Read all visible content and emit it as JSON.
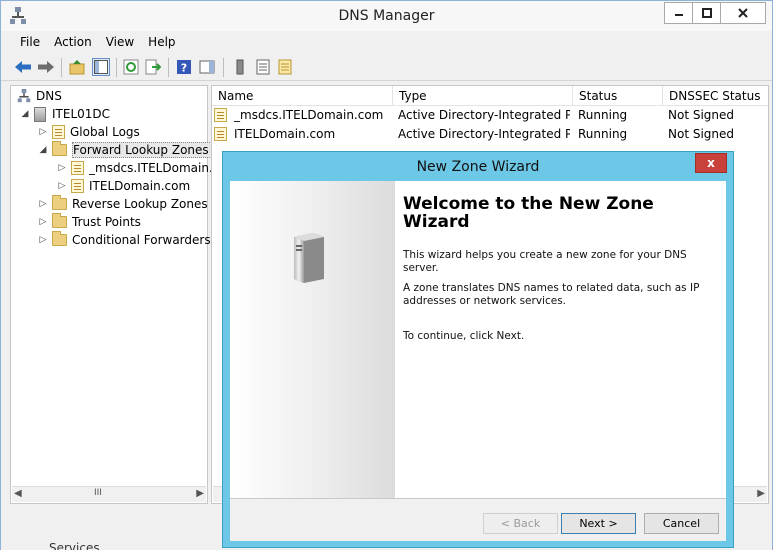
{
  "window": {
    "title": "DNS Manager"
  },
  "menu": [
    "File",
    "Action",
    "View",
    "Help"
  ],
  "tree": {
    "root": "DNS",
    "server": "ITEL01DC",
    "items": [
      {
        "label": "Global Logs"
      },
      {
        "label": "Forward Lookup Zones"
      },
      {
        "label": "_msdcs.ITELDomain.c"
      },
      {
        "label": "ITELDomain.com"
      },
      {
        "label": "Reverse Lookup Zones"
      },
      {
        "label": "Trust Points"
      },
      {
        "label": "Conditional Forwarders"
      }
    ]
  },
  "list": {
    "columns": [
      "Name",
      "Type",
      "Status",
      "DNSSEC Status"
    ],
    "rows": [
      {
        "name": "_msdcs.ITELDomain.com",
        "type": "Active Directory-Integrated Pr...",
        "status": "Running",
        "dnssec": "Not Signed"
      },
      {
        "name": "ITELDomain.com",
        "type": "Active Directory-Integrated Pr...",
        "status": "Running",
        "dnssec": "Not Signed"
      }
    ]
  },
  "status_strip": {
    "text": "Services"
  },
  "wizard": {
    "title": "New Zone Wizard",
    "heading_line1": "Welcome to the New Zone",
    "heading_line2": "Wizard",
    "para1_line1": "This wizard helps you create a new zone for your DNS",
    "para1_line2": "server.",
    "para2_line1": "A zone translates DNS names to related data, such as IP",
    "para2_line2": "addresses or network services.",
    "para3": "To continue, click Next.",
    "buttons": {
      "back": "< Back",
      "next": "Next >",
      "cancel": "Cancel"
    },
    "close_glyph": "x"
  },
  "scroll_glyph": "III"
}
